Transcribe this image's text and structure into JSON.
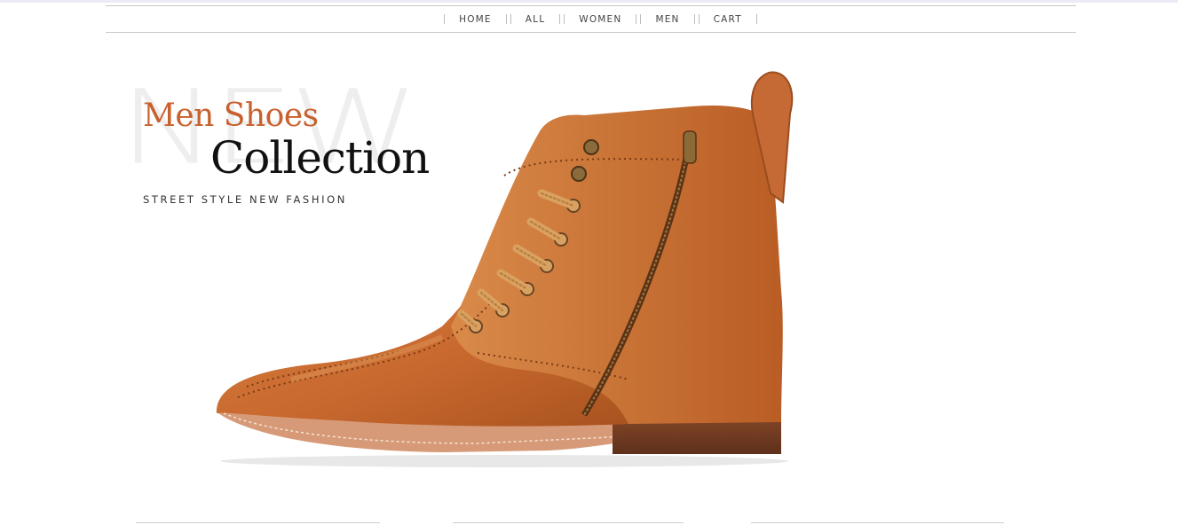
{
  "nav": {
    "items": [
      {
        "label": "HOME"
      },
      {
        "label": "ALL"
      },
      {
        "label": "WOMEN"
      },
      {
        "label": "MEN"
      },
      {
        "label": "CART"
      }
    ]
  },
  "hero": {
    "background_word": "NEW",
    "title_line1": "Men Shoes",
    "title_line2": "Collection",
    "tagline": "STREET STYLE NEW FASHION",
    "image_icon": "leather-boot-image"
  },
  "colors": {
    "accent": "#c8612e",
    "title": "#111111",
    "leather": "#c8692f",
    "sole": "#d79a78",
    "heel": "#6e3b22"
  }
}
